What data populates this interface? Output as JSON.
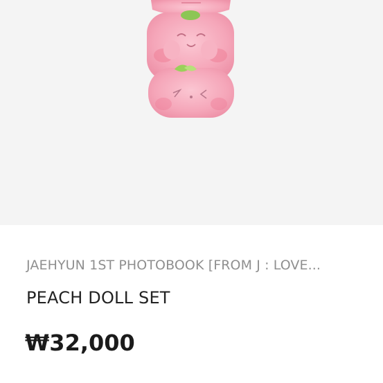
{
  "product": {
    "subtitle": "JAEHYUN 1ST PHOTOBOOK [FROM J : LOVE...",
    "title": "PEACH DOLL SET",
    "price": "₩32,000"
  },
  "colors": {
    "image_background": "#f4f4f4",
    "plush_pink": "#f5a9bb",
    "leaf_green": "#9ccf5c"
  }
}
